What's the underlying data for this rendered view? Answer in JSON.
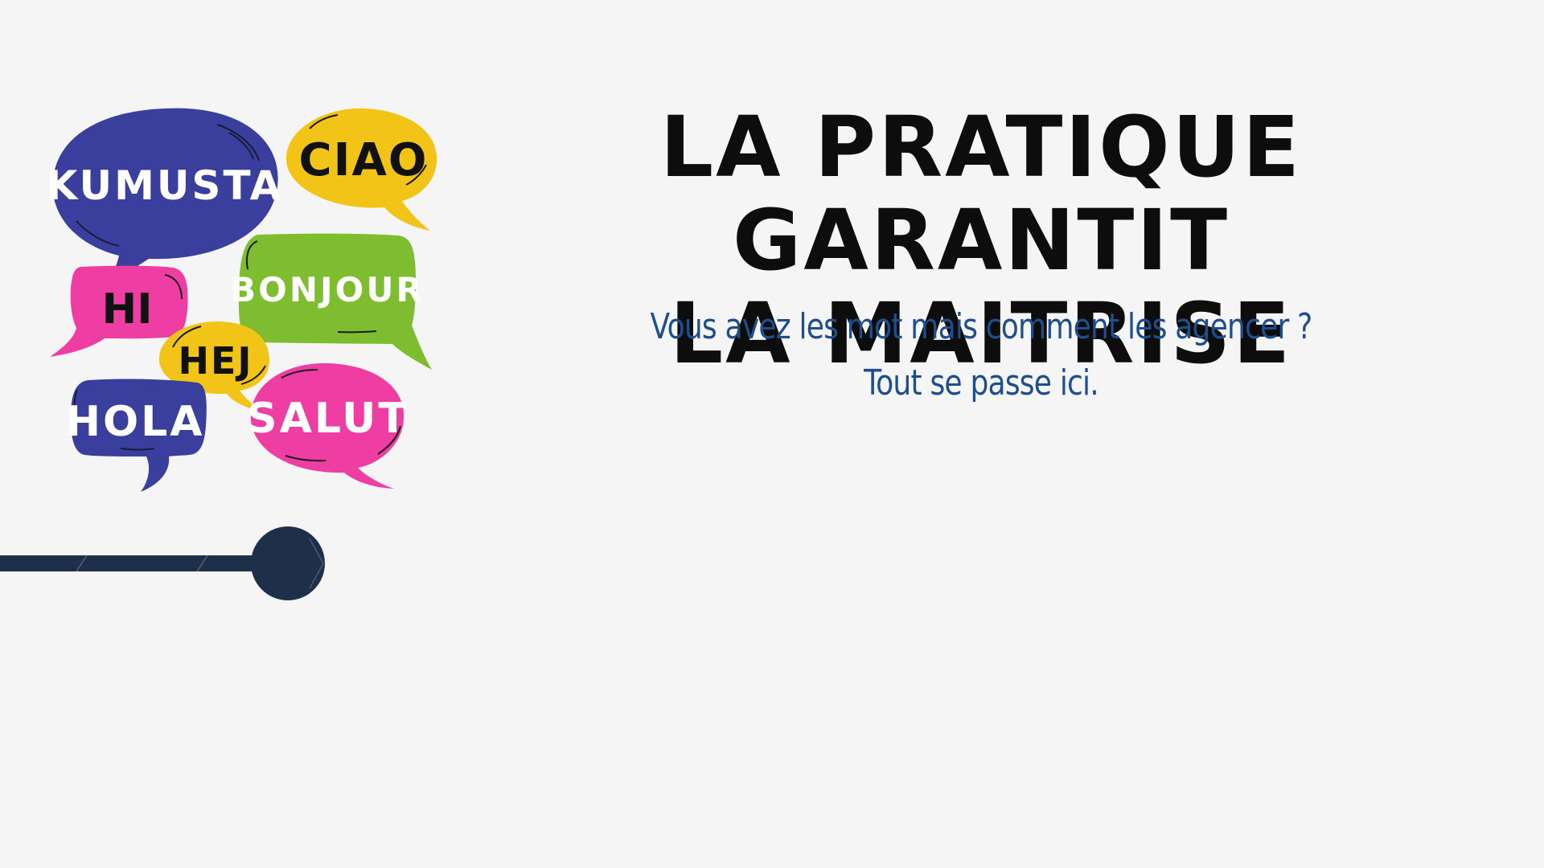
{
  "slide": {
    "title_line1": "LA PRATIQUE GARANTIT",
    "title_line2": "LA MAITRISE",
    "subtitle_line1": "Vous avez les mot mais comment les agencer ?",
    "subtitle_line2": "Tout se passe ici."
  },
  "bubbles": [
    {
      "word": "KUMUSTA",
      "color": "#3a3f9e"
    },
    {
      "word": "CIAO",
      "color": "#f2c418"
    },
    {
      "word": "HI",
      "color": "#ee3ea3"
    },
    {
      "word": "BONJOUR",
      "color": "#7ebd2f"
    },
    {
      "word": "HEJ",
      "color": "#f2c418"
    },
    {
      "word": "HOLA",
      "color": "#3a3f9e"
    },
    {
      "word": "SALUT",
      "color": "#ee3ea3"
    }
  ],
  "colors": {
    "background": "#f5f5f5",
    "title": "#0d0d0d",
    "subtitle": "#1f4e8c",
    "timeline": "#1e2f4a"
  },
  "icons": {
    "bubbles_illustration": "speech-bubbles-icon",
    "timeline_marker": "timeline-dot-icon"
  }
}
